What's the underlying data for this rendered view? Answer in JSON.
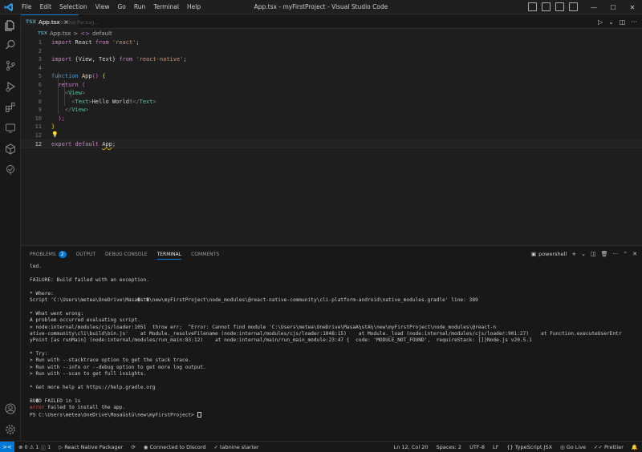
{
  "window": {
    "title": "App.tsx - myFirstProject - Visual Studio Code",
    "menu": [
      "File",
      "Edit",
      "Selection",
      "View",
      "Go",
      "Run",
      "Terminal",
      "Help"
    ]
  },
  "editor": {
    "tab": {
      "icon_text": "TSX",
      "label": "App.tsx",
      "ghost_text": "React Native Packag..."
    },
    "breadcrumb": {
      "file_icon_text": "TSX",
      "file": "App.tsx",
      "separator": ">",
      "symbol_icon": "<>",
      "symbol": "default"
    },
    "line_numbers": [
      "1",
      "2",
      "3",
      "4",
      "5",
      "6",
      "7",
      "8",
      "9",
      "10",
      "11",
      "12"
    ],
    "code": {
      "l1": {
        "kw": "import",
        "name": "React",
        "from": "from",
        "str": "'react'",
        "end": ";"
      },
      "l3": {
        "kw": "import",
        "names": "{View, Text}",
        "from": "from",
        "str": "'react-native'",
        "end": ";"
      },
      "l5": {
        "kw": "function",
        "name": "App",
        "parens": "()",
        "open": "{"
      },
      "l6": {
        "kw": "return",
        "open": "("
      },
      "l7": {
        "tag": "View"
      },
      "l8": {
        "tag": "Text",
        "text": "Hello World!"
      },
      "l9": {
        "tag": "View"
      },
      "l10": {
        "close": ");"
      },
      "l11": {
        "close": "}"
      },
      "l12": {
        "kw": "export",
        "kw2": "default",
        "name": "App",
        "end": ";"
      }
    }
  },
  "panel": {
    "tabs": [
      {
        "label": "PROBLEMS",
        "badge": "2"
      },
      {
        "label": "OUTPUT"
      },
      {
        "label": "DEBUG CONSOLE"
      },
      {
        "label": "TERMINAL"
      },
      {
        "label": "COMMENTS"
      }
    ],
    "shell": "powershell",
    "terminal_lines": [
      "led.",
      "",
      "FAILURE: Build failed with an exception.",
      "",
      "* Where:",
      "Script 'C:\\Users\\metea\\OneDrive\\Masa�st�\\new\\myFirstProject\\node_modules\\@react-native-community\\cli-platform-android\\native_modules.gradle' line: 389",
      "",
      "* What went wrong:",
      "A problem occurred evaluating script.",
      "> node:internal/modules/cjs/loader:1051  throw err;  ^Error: Cannot find module 'C:\\Users\\metea\\OneDrive\\MasaÃ¼stÃ¼\\new\\myFirstProject\\node_modules\\@react-n",
      "ative-community\\cli\\build\\bin.js'    at Module._resolveFilename (node:internal/modules/cjs/loader:1048:15)    at Module._load (node:internal/modules/cjs/loader:901:27)    at Function.executeUserEntr",
      "yPoint [as runMain] (node:internal/modules/run_main:83:12)    at node:internal/main/run_main_module:23:47 {  code: 'MODULE_NOT_FOUND',  requireStack: []}Node.js v20.5.1",
      "",
      "* Try:",
      "> Run with --stacktrace option to get the stack trace.",
      "> Run with --info or --debug option to get more log output.",
      "> Run with --scan to get full insights.",
      "",
      "* Get more help at https://help.gradle.org",
      "",
      "BU�D FAILED in 1s"
    ],
    "error_prefix": "error",
    "error_message": " Failed to install the app.",
    "prompt": "PS C:\\Users\\metea\\OneDrive\\Masaüstü\\new\\myFirstProject> "
  },
  "statusbar": {
    "remote_icon": "><",
    "errors": "0",
    "warnings": "1",
    "info": "1",
    "packager": "React Native Packager",
    "discord": "Connected to Discord",
    "tabnine": "tabnine starter",
    "position": "Ln 12, Col 20",
    "spaces": "Spaces: 2",
    "encoding": "UTF-8",
    "eol": "LF",
    "language": "TypeScript JSX",
    "golive": "Go Live",
    "prettier": "Prettier"
  },
  "colors": {
    "accent": "#0078d4",
    "error": "#f14c4c",
    "keyword": "#c586c0"
  }
}
